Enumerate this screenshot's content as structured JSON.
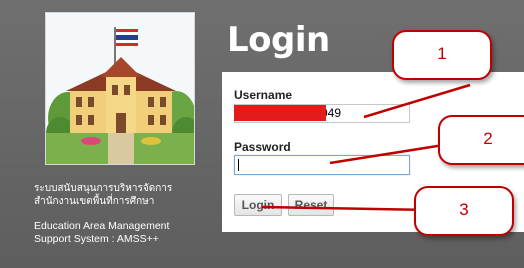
{
  "header": {
    "title": "Login"
  },
  "org": {
    "thai_name": "ระบบสนับสนุนการบริหารจัดการ\nสำนักงานเขตพื้นที่การศึกษา",
    "english_name": "Education Area Management\nSupport System : AMSS++"
  },
  "form": {
    "username_label": "Username",
    "username_value": "049",
    "password_label": "Password",
    "password_value": ""
  },
  "buttons": {
    "login": "Login",
    "reset": "Reset"
  },
  "annotations": {
    "callout1": "1",
    "callout2": "2",
    "callout3": "3"
  },
  "colors": {
    "panel_bg": "#656565",
    "annotation_red": "#c00000",
    "redaction_red": "#e31b1b",
    "focus_border": "#7aa7d6"
  },
  "icons": {
    "logo": "school-building-with-thai-flag"
  }
}
